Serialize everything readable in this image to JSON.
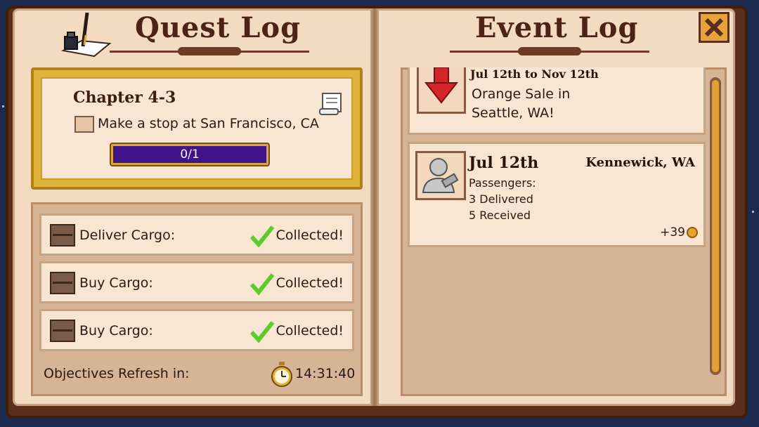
{
  "quest_log": {
    "title": "Quest Log",
    "chapter": {
      "title": "Chapter 4-3",
      "objective": "Make a stop at San Francisco, CA",
      "progress_text": "0/1",
      "progress_fraction": 0
    },
    "objectives": [
      {
        "label": "Deliver Cargo:",
        "status": "Collected!"
      },
      {
        "label": "Buy Cargo:",
        "status": "Collected!"
      },
      {
        "label": "Buy Cargo:",
        "status": "Collected!"
      }
    ],
    "refresh": {
      "label": "Objectives Refresh in:",
      "time": "14:31:40"
    }
  },
  "event_log": {
    "title": "Event Log",
    "events": [
      {
        "date": "Jul 12th to Nov 12th",
        "line1": "Orange Sale in",
        "line2": "Seattle, WA!",
        "icon": "down-arrow-icon"
      },
      {
        "date": "Jul 12th",
        "location": "Kennewick, WA",
        "line1": "Passengers:",
        "line2": "3 Delivered",
        "line3": "5 Received",
        "reward": "+39",
        "icon": "passenger-icon"
      }
    ]
  },
  "colors": {
    "accent": "#e0a234",
    "progress_bar": "#401388",
    "check": "#5dcc2a",
    "sale_arrow": "#d4262a"
  }
}
